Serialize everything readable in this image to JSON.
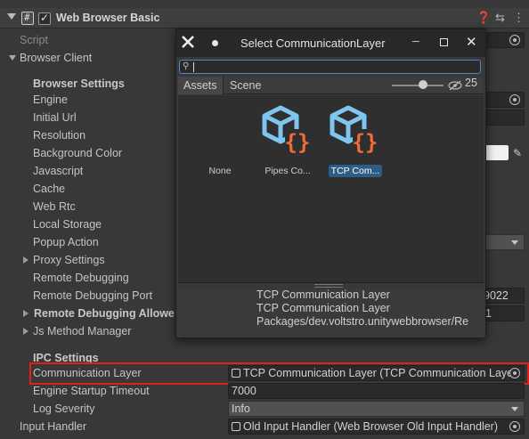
{
  "component": {
    "title": "Web Browser Basic"
  },
  "script_label": "Script",
  "browser_client": {
    "label": "Browser Client",
    "browser_settings": "Browser Settings",
    "engine": "Engine",
    "initial_url": "Initial Url",
    "resolution": "Resolution",
    "background_color": "Background Color",
    "javascript": "Javascript",
    "cache": "Cache",
    "web_rtc": "Web Rtc",
    "local_storage": "Local Storage",
    "popup_action": "Popup Action",
    "proxy_settings": "Proxy Settings",
    "remote_debugging": "Remote Debugging",
    "remote_debugging_port": "Remote Debugging Port",
    "remote_debugging_port_value": "9022",
    "remote_debugging_allowed": "Remote Debugging Allowe",
    "remote_debugging_allowed_value": "1",
    "js_method_manager": "Js Method Manager",
    "ipc_settings": "IPC Settings",
    "communication_layer": "Communication Layer",
    "communication_layer_value": "TCP Communication Layer (TCP Communication Laye",
    "engine_startup_timeout": "Engine Startup Timeout",
    "engine_startup_timeout_value": "7000",
    "log_severity": "Log Severity",
    "log_severity_value": "Info"
  },
  "input_handler": {
    "label": "Input Handler",
    "value": "Old Input Handler (Web Browser Old Input Handler)"
  },
  "popup": {
    "title": "Select CommunicationLayer",
    "search_value": "",
    "tabs": [
      "Assets",
      "Scene"
    ],
    "hidden_count": "25",
    "items": [
      {
        "name": "None"
      },
      {
        "name": "Pipes Co..."
      },
      {
        "name": "TCP Com..."
      }
    ],
    "info": [
      "TCP Communication Layer",
      "TCP Communication Layer",
      "Packages/dev.voltstro.unitywebbrowser/Re"
    ]
  },
  "colors": {
    "selection": "#2c5d87",
    "highlight_border": "#e0201b",
    "asset_blue": "#7ec5f0",
    "asset_orange": "#f06a3c"
  }
}
